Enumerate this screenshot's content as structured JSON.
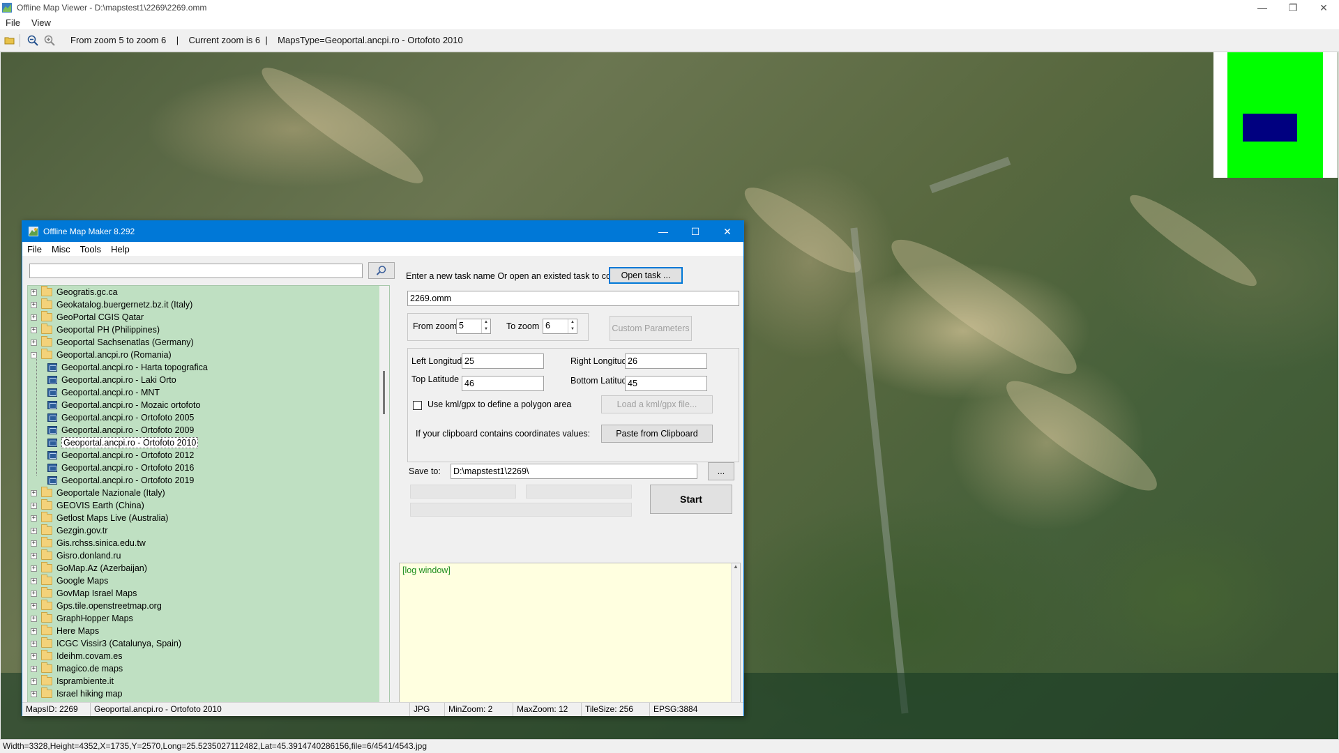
{
  "viewer": {
    "title": "Offline Map Viewer - D:\\mapstest1\\2269\\2269.omm",
    "menu": [
      "File",
      "View"
    ],
    "toolbar_status": "From zoom 5 to zoom 6    |    Current zoom is 6  |    MapsType=Geoportal.ancpi.ro - Ortofoto 2010",
    "bottom_status": "Width=3328,Height=4352,X=1735,Y=2570,Long=25.5235027112482,Lat=45.3914740286156,file=6/4541/4543.jpg",
    "icons": [
      "open-folder-icon",
      "zoom-out-icon",
      "zoom-in-icon"
    ]
  },
  "dialog": {
    "title": "Offline Map Maker 8.292",
    "menu": [
      "File",
      "Misc",
      "Tools",
      "Help"
    ],
    "search_value": "",
    "tree": [
      {
        "label": "Geogratis.gc.ca",
        "type": "folder",
        "expanded": false
      },
      {
        "label": "Geokatalog.buergernetz.bz.it (Italy)",
        "type": "folder",
        "expanded": false
      },
      {
        "label": "GeoPortal CGIS Qatar",
        "type": "folder",
        "expanded": false
      },
      {
        "label": "Geoportal PH (Philippines)",
        "type": "folder",
        "expanded": false
      },
      {
        "label": "Geoportal Sachsenatlas (Germany)",
        "type": "folder",
        "expanded": false
      },
      {
        "label": "Geoportal.ancpi.ro (Romania)",
        "type": "folder",
        "expanded": true
      },
      {
        "label": "Geoportal.ancpi.ro - Harta topografica",
        "type": "map"
      },
      {
        "label": "Geoportal.ancpi.ro - Laki Orto",
        "type": "map"
      },
      {
        "label": "Geoportal.ancpi.ro - MNT",
        "type": "map"
      },
      {
        "label": "Geoportal.ancpi.ro - Mozaic ortofoto",
        "type": "map"
      },
      {
        "label": "Geoportal.ancpi.ro - Ortofoto 2005",
        "type": "map"
      },
      {
        "label": "Geoportal.ancpi.ro - Ortofoto 2009",
        "type": "map"
      },
      {
        "label": "Geoportal.ancpi.ro - Ortofoto 2010",
        "type": "map",
        "selected": true
      },
      {
        "label": "Geoportal.ancpi.ro - Ortofoto 2012",
        "type": "map"
      },
      {
        "label": "Geoportal.ancpi.ro - Ortofoto 2016",
        "type": "map"
      },
      {
        "label": "Geoportal.ancpi.ro - Ortofoto 2019",
        "type": "map"
      },
      {
        "label": "Geoportale Nazionale (Italy)",
        "type": "folder",
        "expanded": false
      },
      {
        "label": "GEOVIS Earth (China)",
        "type": "folder",
        "expanded": false
      },
      {
        "label": "Getlost Maps Live (Australia)",
        "type": "folder",
        "expanded": false
      },
      {
        "label": "Gezgin.gov.tr",
        "type": "folder",
        "expanded": false
      },
      {
        "label": "Gis.rchss.sinica.edu.tw",
        "type": "folder",
        "expanded": false
      },
      {
        "label": "Gisro.donland.ru",
        "type": "folder",
        "expanded": false
      },
      {
        "label": "GoMap.Az (Azerbaijan)",
        "type": "folder",
        "expanded": false
      },
      {
        "label": "Google Maps",
        "type": "folder",
        "expanded": false
      },
      {
        "label": "GovMap Israel Maps",
        "type": "folder",
        "expanded": false
      },
      {
        "label": "Gps.tile.openstreetmap.org",
        "type": "folder",
        "expanded": false
      },
      {
        "label": "GraphHopper Maps",
        "type": "folder",
        "expanded": false
      },
      {
        "label": "Here Maps",
        "type": "folder",
        "expanded": false
      },
      {
        "label": "ICGC Vissir3 (Catalunya, Spain)",
        "type": "folder",
        "expanded": false
      },
      {
        "label": "Ideihm.covam.es",
        "type": "folder",
        "expanded": false
      },
      {
        "label": "Imagico.de maps",
        "type": "folder",
        "expanded": false
      },
      {
        "label": "Isprambiente.it",
        "type": "folder",
        "expanded": false
      },
      {
        "label": "Israel hiking map",
        "type": "folder",
        "expanded": false
      }
    ],
    "task_prompt": "Enter a new task name Or open an existed task to continue:",
    "open_task_label": "Open task ...",
    "task_name": "2269.omm",
    "from_zoom_label": "From zoom",
    "from_zoom_value": "5",
    "to_zoom_label": "To zoom",
    "to_zoom_value": "6",
    "custom_params_label": "Custom Parameters",
    "left_lon_label": "Left Longitude",
    "left_lon_value": "25",
    "right_lon_label": "Right Longitude",
    "right_lon_value": "26",
    "top_lat_label": "Top Latitude",
    "top_lat_value": "46",
    "bottom_lat_label": "Bottom Latitude",
    "bottom_lat_value": "45",
    "kml_label": "Use kml/gpx to define a polygon area",
    "kml_checked": false,
    "load_kml_label": "Load a kml/gpx file...",
    "clipboard_prompt": "If your clipboard contains coordinates values:",
    "paste_label": "Paste from Clipboard",
    "save_to_label": "Save to:",
    "save_to_value": "D:\\mapstest1\\2269\\",
    "browse_label": "...",
    "start_label": "Start",
    "log_text": "[log window]",
    "status": {
      "maps_id": "MapsID: 2269",
      "map_name": "Geoportal.ancpi.ro - Ortofoto 2010",
      "format": "JPG",
      "min_zoom": "MinZoom: 2",
      "max_zoom": "MaxZoom: 12",
      "tile_size": "TileSize: 256",
      "epsg": "EPSG:3884"
    }
  }
}
